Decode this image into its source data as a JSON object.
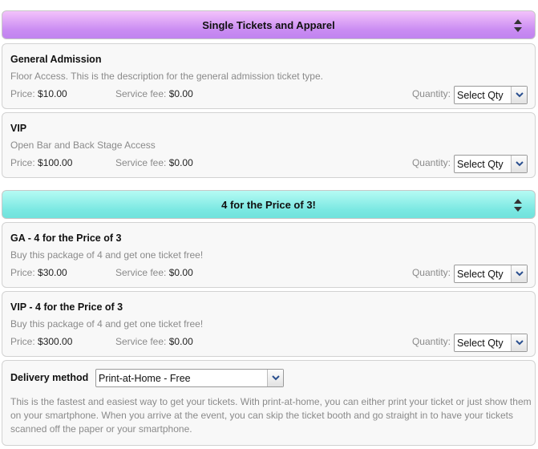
{
  "sections": [
    {
      "title": "Single Tickets and Apparel"
    },
    {
      "title": "4 for the Price of 3!"
    }
  ],
  "tickets": [
    {
      "name": "General Admission",
      "description": "Floor Access. This is the description for the general admission ticket type.",
      "price": "$10.00",
      "fee": "$0.00"
    },
    {
      "name": "VIP",
      "description": "Open Bar and Back Stage Access",
      "price": "$100.00",
      "fee": "$0.00"
    },
    {
      "name": "GA - 4 for the Price of 3",
      "description": "Buy this package of 4 and get one ticket free!",
      "price": "$30.00",
      "fee": "$0.00"
    },
    {
      "name": "VIP - 4 for the Price of 3",
      "description": "Buy this package of 4 and get one ticket free!",
      "price": "$300.00",
      "fee": "$0.00"
    }
  ],
  "labels": {
    "price": "Price:",
    "service_fee": "Service fee:",
    "quantity": "Quantity:",
    "select_qty": "Select Qty"
  },
  "delivery": {
    "label": "Delivery method",
    "selected": "Print-at-Home - Free",
    "description": "This is the fastest and easiest way to get your tickets. With print-at-home, you can either print your ticket or just show them on your smartphone. When you arrive at the event, you can skip the ticket booth and go straight in to have your tickets scanned off the paper or your smartphone."
  },
  "colors": {
    "section1_header": "#c98bf2",
    "section2_header": "#7be8e2",
    "select_arrow": "#2a4f8f"
  },
  "icons": {
    "sort": "sort-arrows-icon",
    "dropdown": "chevron-down-icon"
  }
}
